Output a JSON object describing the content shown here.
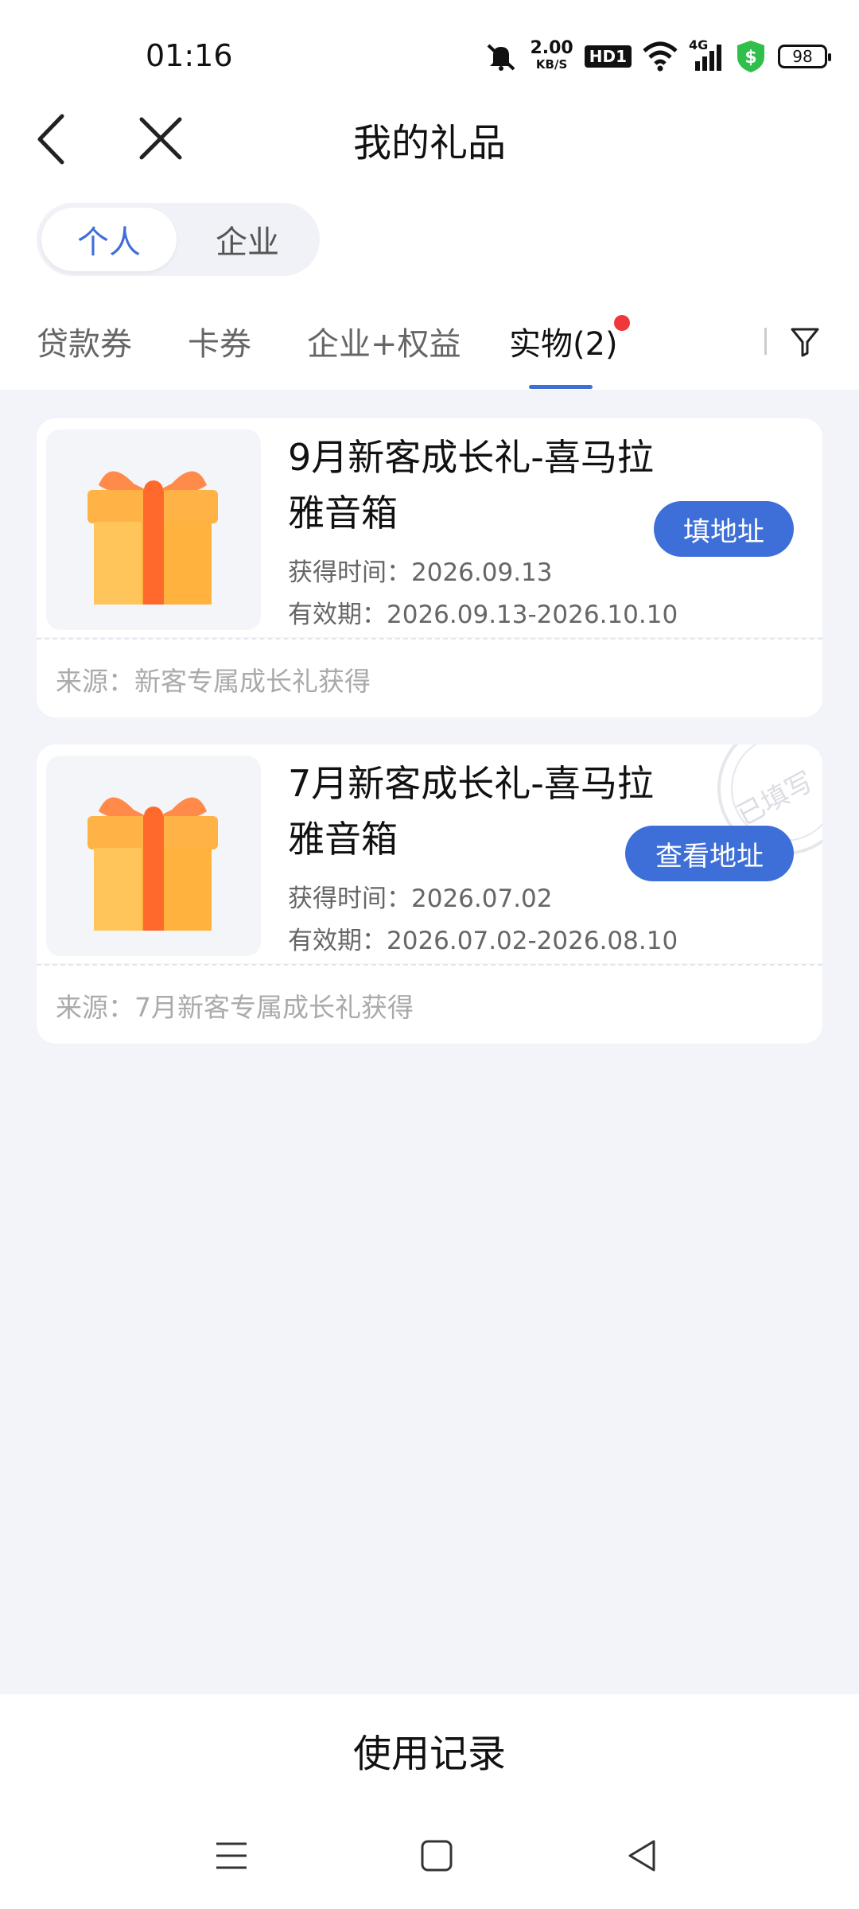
{
  "status_bar": {
    "time": "01:16",
    "net_speed": "2.00",
    "net_unit": "KB/S",
    "hd_label": "HD1",
    "signal_label": "4G",
    "battery": "98"
  },
  "header": {
    "title": "我的礼品"
  },
  "segment": {
    "items": [
      "个人",
      "企业"
    ],
    "active": "个人"
  },
  "tabs": {
    "items": [
      "贷款券",
      "卡券",
      "企业+权益",
      "实物(2)"
    ],
    "active_index": 3,
    "badge_color": "#f0373a"
  },
  "gifts": [
    {
      "title": "9月新客成长礼-喜马拉雅音箱",
      "obtained": "获得时间：2026.09.13",
      "validity": "有效期：2026.09.13-2026.10.10",
      "button": "填地址",
      "source": "来源：新客专属成长礼获得",
      "stamp": ""
    },
    {
      "title": "7月新客成长礼-喜马拉雅音箱",
      "obtained": "获得时间：2026.07.02",
      "validity": "有效期：2026.07.02-2026.08.10",
      "button": "查看地址",
      "source": "来源：7月新客专属成长礼获得",
      "stamp": "已填写"
    }
  ],
  "footer": {
    "history_label": "使用记录"
  },
  "colors": {
    "accent": "#3e6fd8",
    "background": "#f3f4f9"
  }
}
